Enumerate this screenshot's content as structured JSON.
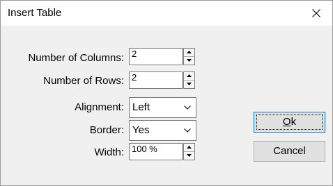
{
  "window": {
    "title": "Insert Table"
  },
  "fields": {
    "columns": {
      "label": "Number of Columns:",
      "value": "2"
    },
    "rows": {
      "label": "Number of Rows:",
      "value": "2"
    },
    "alignment": {
      "label": "Alignment:",
      "value": "Left"
    },
    "border": {
      "label": "Border:",
      "value": "Yes"
    },
    "width": {
      "label": "Width:",
      "value": "100 %"
    }
  },
  "buttons": {
    "ok_mnemonic": "O",
    "ok_rest": "k",
    "cancel": "Cancel"
  },
  "icons": {
    "close": "close-icon",
    "spin_up": "arrow-up-icon",
    "spin_down": "arrow-down-icon",
    "dropdown": "chevron-down-icon"
  },
  "colors": {
    "dialog_bg": "#f0f0f0",
    "title_bg": "#ffffff",
    "default_button_border": "#0078d7"
  }
}
